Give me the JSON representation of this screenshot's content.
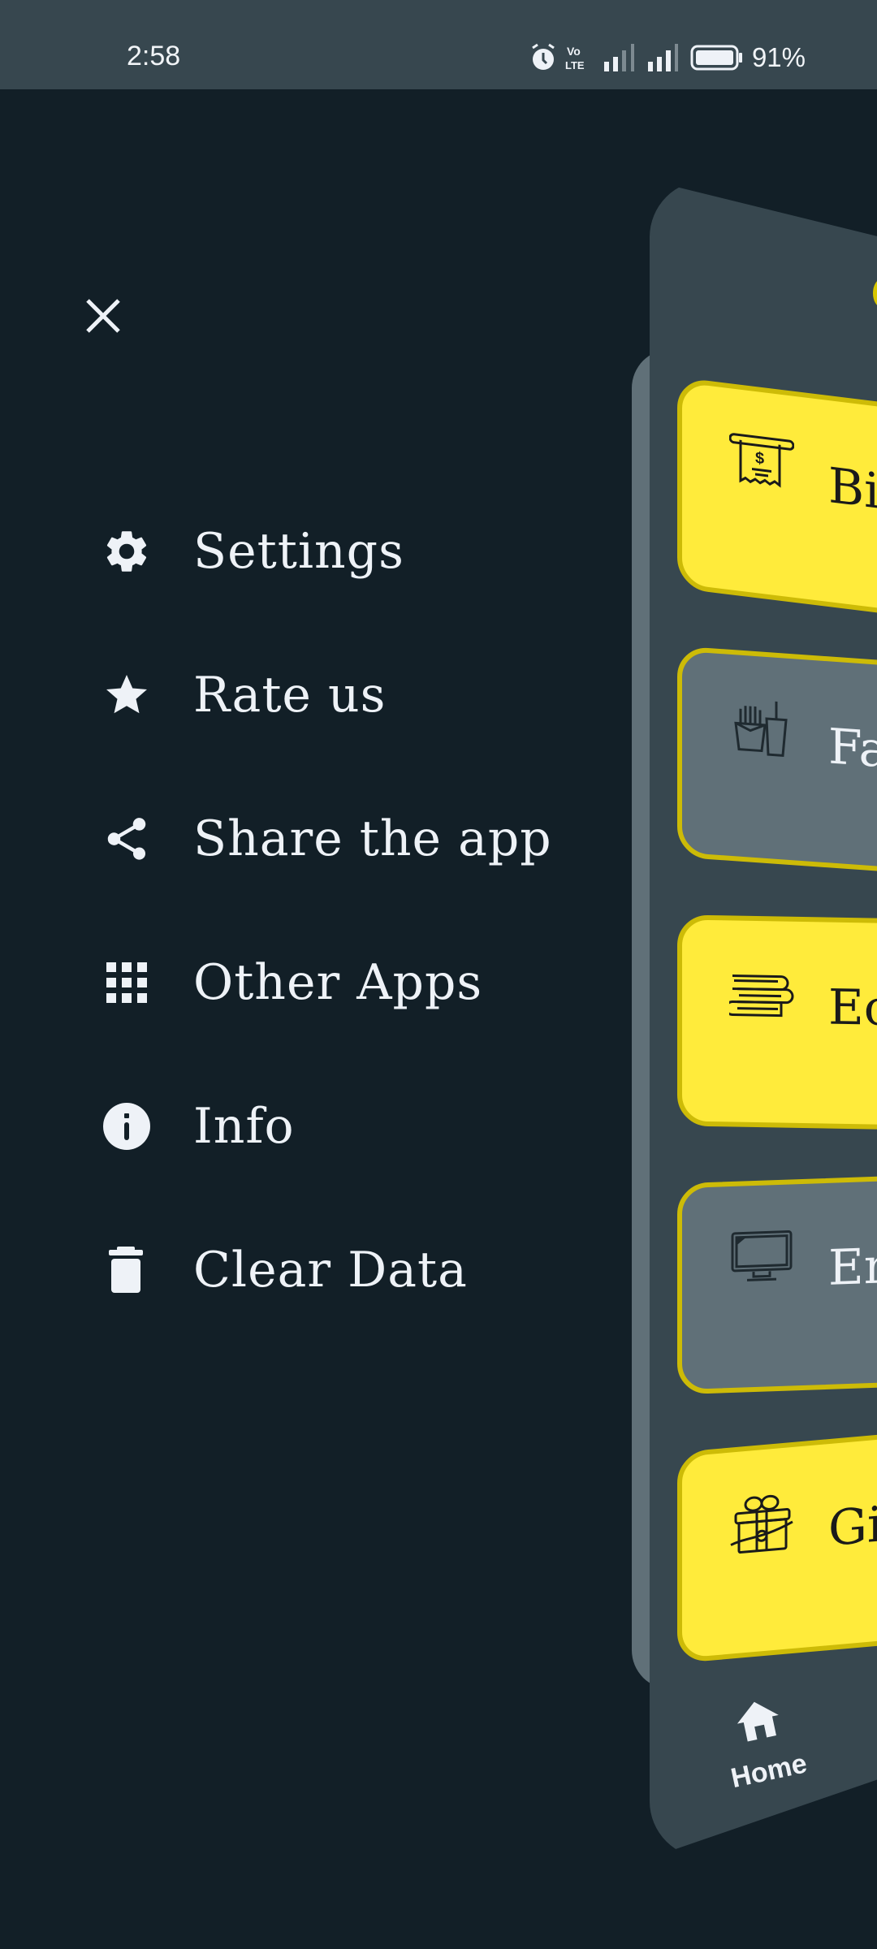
{
  "status_bar": {
    "time": "2:58",
    "battery_percent": "91%",
    "icons": [
      "alarm-icon",
      "volte-icon",
      "signal-icon",
      "signal-icon",
      "battery-icon"
    ]
  },
  "drawer": {
    "close_icon": "close-icon",
    "items": [
      {
        "label": "Settings",
        "icon": "gear-icon"
      },
      {
        "label": "Rate us",
        "icon": "star-icon"
      },
      {
        "label": "Share the app",
        "icon": "share-icon"
      },
      {
        "label": "Other Apps",
        "icon": "apps-grid-icon"
      },
      {
        "label": "Info",
        "icon": "info-icon"
      },
      {
        "label": "Clear Data",
        "icon": "trash-icon"
      }
    ]
  },
  "app_preview": {
    "cards": [
      {
        "title": "Bi",
        "icon": "bill-receipt-icon",
        "style": "yellow"
      },
      {
        "title": "Fa",
        "icon": "fast-food-icon",
        "style": "grey"
      },
      {
        "title": "Ec",
        "icon": "books-icon",
        "style": "yellow"
      },
      {
        "title": "En",
        "icon": "tv-monitor-icon",
        "style": "grey"
      },
      {
        "title": "Gi",
        "icon": "gift-icon",
        "style": "yellow"
      }
    ],
    "bottom_nav": {
      "home_label": "Home",
      "icon": "home-icon"
    }
  },
  "colors": {
    "background": "#121f27",
    "status_bar": "#37474f",
    "panel": "#37474f",
    "accent_yellow": "#ffeb3b",
    "card_border": "#cdbb07",
    "card_grey": "#607078",
    "text_light": "#eef2f7"
  }
}
